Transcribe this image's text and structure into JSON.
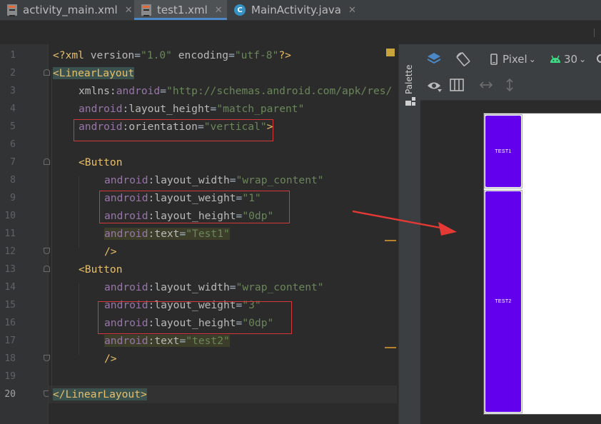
{
  "tabs": [
    {
      "label": "activity_main.xml",
      "close": "✕",
      "active": false
    },
    {
      "label": "test1.xml",
      "close": "✕",
      "active": true
    },
    {
      "label": "MainActivity.java",
      "close": "✕",
      "active": false
    }
  ],
  "gutter": {
    "line_numbers": [
      "1",
      "2",
      "3",
      "4",
      "5",
      "6",
      "7",
      "8",
      "9",
      "10",
      "11",
      "12",
      "13",
      "14",
      "15",
      "16",
      "17",
      "18",
      "19",
      "20"
    ],
    "current_line": "20"
  },
  "code": {
    "l1_open": "<?xml ",
    "l1_a1": "version",
    "l1_eq1": "=",
    "l1_v1": "\"1.0\"",
    "l1_sp": " ",
    "l1_a2": "encoding",
    "l1_eq2": "=",
    "l1_v2": "\"utf-8\"",
    "l1_close": "?>",
    "l2_tag": "<LinearLayout",
    "l3_a": "xmlns:",
    "l3_ns": "android",
    "l3_eq": "=",
    "l3_v": "\"http://schemas.android.com/apk/res/",
    "l4_ns": "android",
    "l4_colon": ":",
    "l4_a": "layout_height",
    "l4_eq": "=",
    "l4_v": "\"match_parent\"",
    "l5_ns": "android",
    "l5_colon": ":",
    "l5_a": "orientation",
    "l5_eq": "=",
    "l5_v": "\"vertical\"",
    "l5_close": ">",
    "l7_tag": "<Button",
    "l8_ns": "android",
    "l8_colon": ":",
    "l8_a": "layout_width",
    "l8_eq": "=",
    "l8_v": "\"wrap_content\"",
    "l9_ns": "android",
    "l9_colon": ":",
    "l9_a": "layout_weight",
    "l9_eq": "=",
    "l9_v": "\"1\"",
    "l10_ns": "android",
    "l10_colon": ":",
    "l10_a": "layout_height",
    "l10_eq": "=",
    "l10_v": "\"0dp\"",
    "l11_ns": "android",
    "l11_colon": ":",
    "l11_a": "text",
    "l11_eq": "=",
    "l11_v": "\"Test1\"",
    "l12_close": "/>",
    "l13_tag": "<Button",
    "l14_ns": "android",
    "l14_colon": ":",
    "l14_a": "layout_width",
    "l14_eq": "=",
    "l14_v": "\"wrap_content\"",
    "l15_ns": "android",
    "l15_colon": ":",
    "l15_a": "layout_weight",
    "l15_eq": "=",
    "l15_v": "\"3\"",
    "l16_ns": "android",
    "l16_colon": ":",
    "l16_a": "layout_height",
    "l16_eq": "=",
    "l16_v": "\"0dp\"",
    "l17_ns": "android",
    "l17_colon": ":",
    "l17_a": "text",
    "l17_eq": "=",
    "l17_v": "\"test2\"",
    "l18_close": "/>",
    "l20_tag": "</LinearLayout>"
  },
  "palette": {
    "label": "Palette"
  },
  "design_toolbar": {
    "device": "Pixel",
    "api_level": "30",
    "dropdown": "⌄"
  },
  "preview": {
    "button1_text": "TEST1",
    "button2_text": "TEST2"
  },
  "colors": {
    "accent": "#4a88c7",
    "button": "#6200ee",
    "annotation_red": "#e53935"
  }
}
